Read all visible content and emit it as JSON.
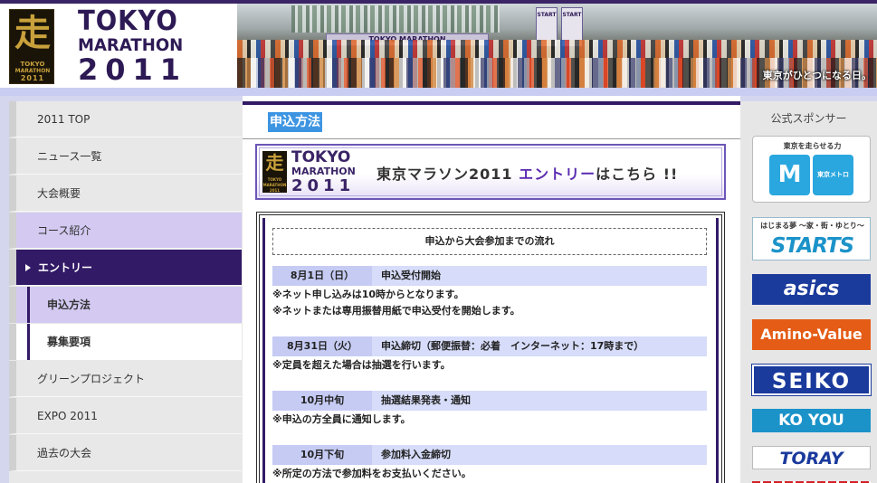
{
  "header": {
    "logo_kanji": "走",
    "logo_small_1": "TOKYO",
    "logo_small_2": "MARATHON",
    "logo_small_3": "2011",
    "logo_text_1": "TOKYO",
    "logo_text_2": "MARATHON",
    "logo_text_3": "2011",
    "hero_banner_text": "TOKYO MARATHON",
    "hero_start_1": "START",
    "hero_start_2": "START",
    "hero_caption": "東京がひとつになる日。"
  },
  "nav": {
    "items": [
      {
        "label": "2011 TOP"
      },
      {
        "label": "ニュース一覧"
      },
      {
        "label": "大会概要"
      },
      {
        "label": "コース紹介"
      },
      {
        "label": "エントリー"
      },
      {
        "label": "申込方法"
      },
      {
        "label": "募集要項"
      },
      {
        "label": "グリーンプロジェクト"
      },
      {
        "label": "EXPO 2011"
      },
      {
        "label": "過去の大会"
      }
    ]
  },
  "main": {
    "page_title": "申込方法",
    "banner": {
      "mark_kanji": "走",
      "mark_t1": "TOKYO",
      "mark_t2": "MARATHON",
      "mark_t3": "2011",
      "logo_l1": "TOKYO",
      "logo_l2": "MARATHON",
      "logo_l3": "2011",
      "cta_prefix": "東京マラソン2011 ",
      "cta_highlight": "エントリー",
      "cta_suffix": "はこちら !!"
    },
    "flow_title": "申込から大会参加までの流れ",
    "steps": [
      {
        "date": "8月1日（日）",
        "label": "申込受付開始",
        "notes": [
          "※ネット申し込みは10時からとなります。",
          "※ネットまたは専用振替用紙で申込受付を開始します。"
        ]
      },
      {
        "date": "8月31日（火）",
        "label": "申込締切（郵便振替：必着　インターネット：17時まで）",
        "notes": [
          "※定員を超えた場合は抽選を行います。"
        ]
      },
      {
        "date": "10月中旬",
        "label": "抽選結果発表・通知",
        "notes": [
          "※申込の方全員に通知します。"
        ]
      },
      {
        "date": "10月下旬",
        "label": "参加料入金締切",
        "notes": [
          "※所定の方法で参加料をお支払いください。"
        ]
      }
    ]
  },
  "sponsors": {
    "heading": "公式スポンサー",
    "metro_caption": "東京を走らせる力",
    "metro_m": "M",
    "metro_name": "東京メトロ",
    "starts_sub": "はじまる夢 〜家・街・ゆとり〜",
    "starts_name": "STARTS",
    "asics": "asics",
    "amino": "Amino-Value",
    "seiko": "SEIKO",
    "koyou": "KO YOU",
    "toray": "TORAY"
  }
}
